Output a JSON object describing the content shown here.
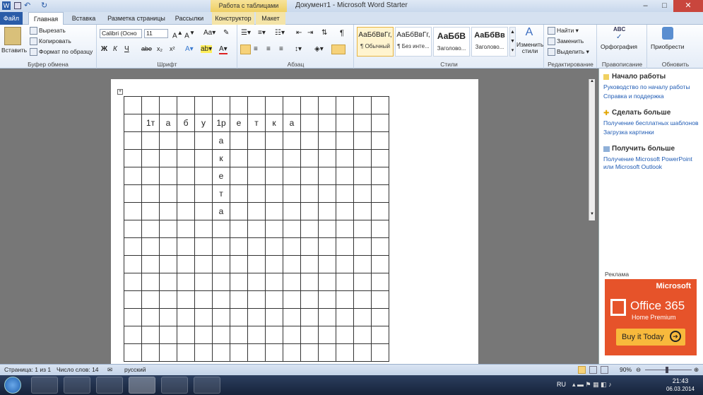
{
  "window": {
    "title": "Документ1 - Microsoft Word Starter",
    "context_group": "Работа с таблицами",
    "min": "–",
    "max": "□",
    "close": "✕"
  },
  "qat": {
    "icons": [
      "word-icon",
      "save-icon",
      "undo-icon",
      "redo-icon"
    ]
  },
  "tabs": [
    "Файл",
    "Главная",
    "Вставка",
    "Разметка страницы",
    "Рассылки",
    "Конструктор",
    "Макет"
  ],
  "clipboard": {
    "paste": "Вставить",
    "cut": "Вырезать",
    "copy": "Копировать",
    "format": "Формат по образцу",
    "label": "Буфер обмена"
  },
  "font": {
    "name": "Calibri (Осно",
    "size": "11",
    "label": "Шрифт"
  },
  "paragraph": {
    "label": "Абзац"
  },
  "styles": {
    "label": "Стили",
    "items": [
      {
        "preview": "АаБбВвГг,",
        "name": "¶ Обычный"
      },
      {
        "preview": "АаБбВвГг,",
        "name": "¶ Без инте..."
      },
      {
        "preview": "АаБбВ",
        "name": "Заголово..."
      },
      {
        "preview": "АаБбВв",
        "name": "Заголово..."
      }
    ],
    "change": "Изменить стили"
  },
  "editing": {
    "find": "Найти",
    "replace": "Заменить",
    "select": "Выделить",
    "label": "Редактирование"
  },
  "proofing": {
    "spelling": "Орфография",
    "label": "Правописание",
    "abc": "ABC"
  },
  "update": {
    "upgrade": "Приобрести",
    "label": "Обновить"
  },
  "grid_rows": [
    [
      "",
      "",
      "",
      "",
      "",
      "",
      "",
      "",
      "",
      "",
      "",
      "",
      "",
      "",
      ""
    ],
    [
      "",
      "1т",
      "а",
      "б",
      "у",
      "1р",
      "е",
      "т",
      "к",
      "а",
      "",
      "",
      "",
      "",
      ""
    ],
    [
      "",
      "",
      "",
      "",
      "",
      "а",
      "",
      "",
      "",
      "",
      "",
      "",
      "",
      "",
      ""
    ],
    [
      "",
      "",
      "",
      "",
      "",
      "к",
      "",
      "",
      "",
      "",
      "",
      "",
      "",
      "",
      ""
    ],
    [
      "",
      "",
      "",
      "",
      "",
      "е",
      "",
      "",
      "",
      "",
      "",
      "",
      "",
      "",
      ""
    ],
    [
      "",
      "",
      "",
      "",
      "",
      "т",
      "",
      "",
      "",
      "",
      "",
      "",
      "",
      "",
      ""
    ],
    [
      "",
      "",
      "",
      "",
      "",
      "а",
      "",
      "",
      "",
      "",
      "",
      "",
      "",
      "",
      ""
    ],
    [
      "",
      "",
      "",
      "",
      "",
      "",
      "",
      "",
      "",
      "",
      "",
      "",
      "",
      "",
      ""
    ],
    [
      "",
      "",
      "",
      "",
      "",
      "",
      "",
      "",
      "",
      "",
      "",
      "",
      "",
      "",
      ""
    ],
    [
      "",
      "",
      "",
      "",
      "",
      "",
      "",
      "",
      "",
      "",
      "",
      "",
      "",
      "",
      ""
    ],
    [
      "",
      "",
      "",
      "",
      "",
      "",
      "",
      "",
      "",
      "",
      "",
      "",
      "",
      "",
      ""
    ],
    [
      "",
      "",
      "",
      "",
      "",
      "",
      "",
      "",
      "",
      "",
      "",
      "",
      "",
      "",
      ""
    ],
    [
      "",
      "",
      "",
      "",
      "",
      "",
      "",
      "",
      "",
      "",
      "",
      "",
      "",
      "",
      ""
    ],
    [
      "",
      "",
      "",
      "",
      "",
      "",
      "",
      "",
      "",
      "",
      "",
      "",
      "",
      "",
      ""
    ],
    [
      "",
      "",
      "",
      "",
      "",
      "",
      "",
      "",
      "",
      "",
      "",
      "",
      "",
      "",
      ""
    ]
  ],
  "taskpane": {
    "s1": {
      "title": "Начало работы",
      "links": [
        "Руководство по началу работы",
        "Справка и поддержка"
      ]
    },
    "s2": {
      "title": "Сделать больше",
      "links": [
        "Получение бесплатных шаблонов",
        "Загрузка картинки"
      ]
    },
    "s3": {
      "title": "Получить больше",
      "links": [
        "Получение Microsoft PowerPoint или Microsoft Outlook"
      ]
    },
    "ad_label": "Реклама",
    "ad": {
      "brand": "Microsoft",
      "product": "Office 365",
      "edition": "Home Premium",
      "cta": "Buy it Today"
    }
  },
  "status": {
    "page": "Страница: 1 из 1",
    "words": "Число слов: 14",
    "lang": "русский",
    "zoom": "90%"
  },
  "taskbar": {
    "lang": "RU",
    "time": "21:43",
    "date": "06.03.2014"
  }
}
